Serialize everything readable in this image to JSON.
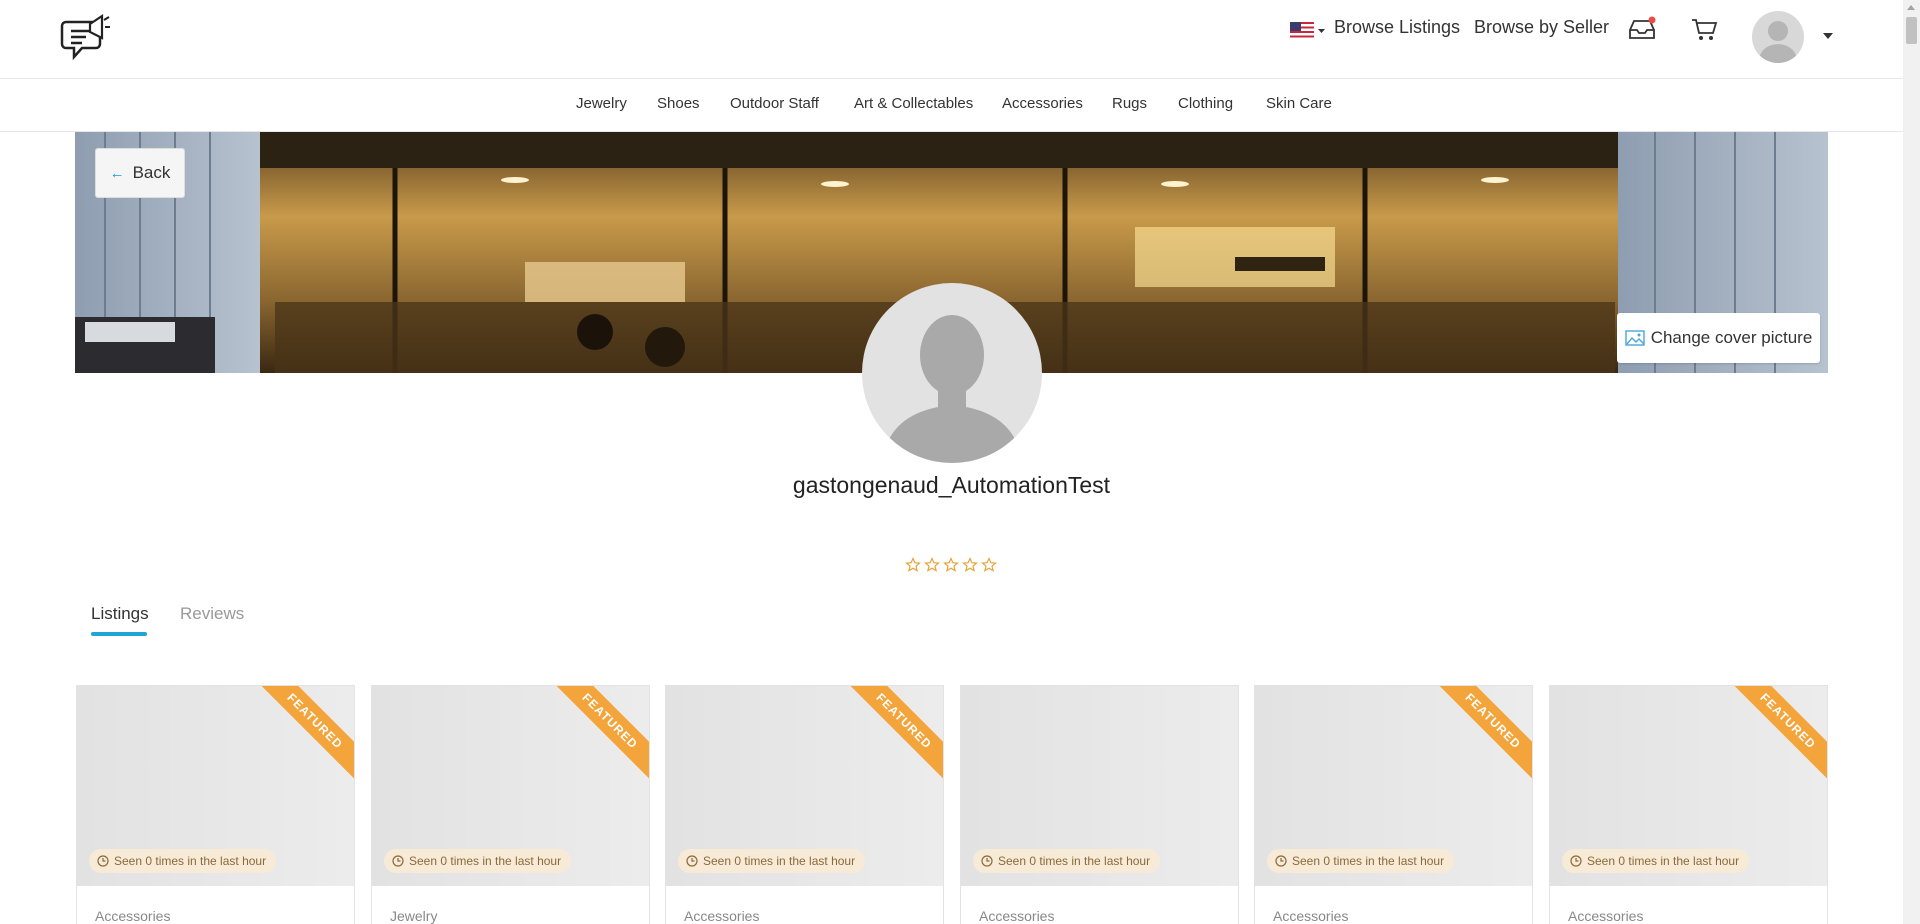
{
  "header": {
    "logo_icon": "megaphone-chat-icon",
    "flag_icon": "us-flag-icon",
    "browse_listings": "Browse Listings",
    "browse_by_seller": "Browse by Seller",
    "inbox_icon": "inbox-icon",
    "cart_icon": "cart-icon",
    "notification_color": "#e94b4b"
  },
  "categories": [
    "Jewelry",
    "Shoes",
    "Outdoor Staff",
    "Art & Collectables",
    "Accessories",
    "Rugs",
    "Clothing",
    "Skin Care"
  ],
  "cover": {
    "back_label": "Back",
    "change_cover_label": "Change cover picture"
  },
  "profile": {
    "username": "gastongenaud_AutomationTest",
    "rating": 0,
    "max_rating": 5
  },
  "tabs": [
    {
      "label": "Listings",
      "active": true
    },
    {
      "label": "Reviews",
      "active": false
    }
  ],
  "colors": {
    "accent": "#1fa4d7",
    "featured": "#f3a43a",
    "star": "#e8a33a"
  },
  "listings": [
    {
      "featured": true,
      "badge": "FEATURED",
      "seen": "Seen 0 times in the last hour",
      "category": "Accessories"
    },
    {
      "featured": true,
      "badge": "FEATURED",
      "seen": "Seen 0 times in the last hour",
      "category": "Jewelry"
    },
    {
      "featured": true,
      "badge": "FEATURED",
      "seen": "Seen 0 times in the last hour",
      "category": "Accessories"
    },
    {
      "featured": false,
      "badge": "",
      "seen": "Seen 0 times in the last hour",
      "category": "Accessories"
    },
    {
      "featured": true,
      "badge": "FEATURED",
      "seen": "Seen 0 times in the last hour",
      "category": "Accessories"
    },
    {
      "featured": true,
      "badge": "FEATURED",
      "seen": "Seen 0 times in the last hour",
      "category": "Accessories"
    }
  ]
}
